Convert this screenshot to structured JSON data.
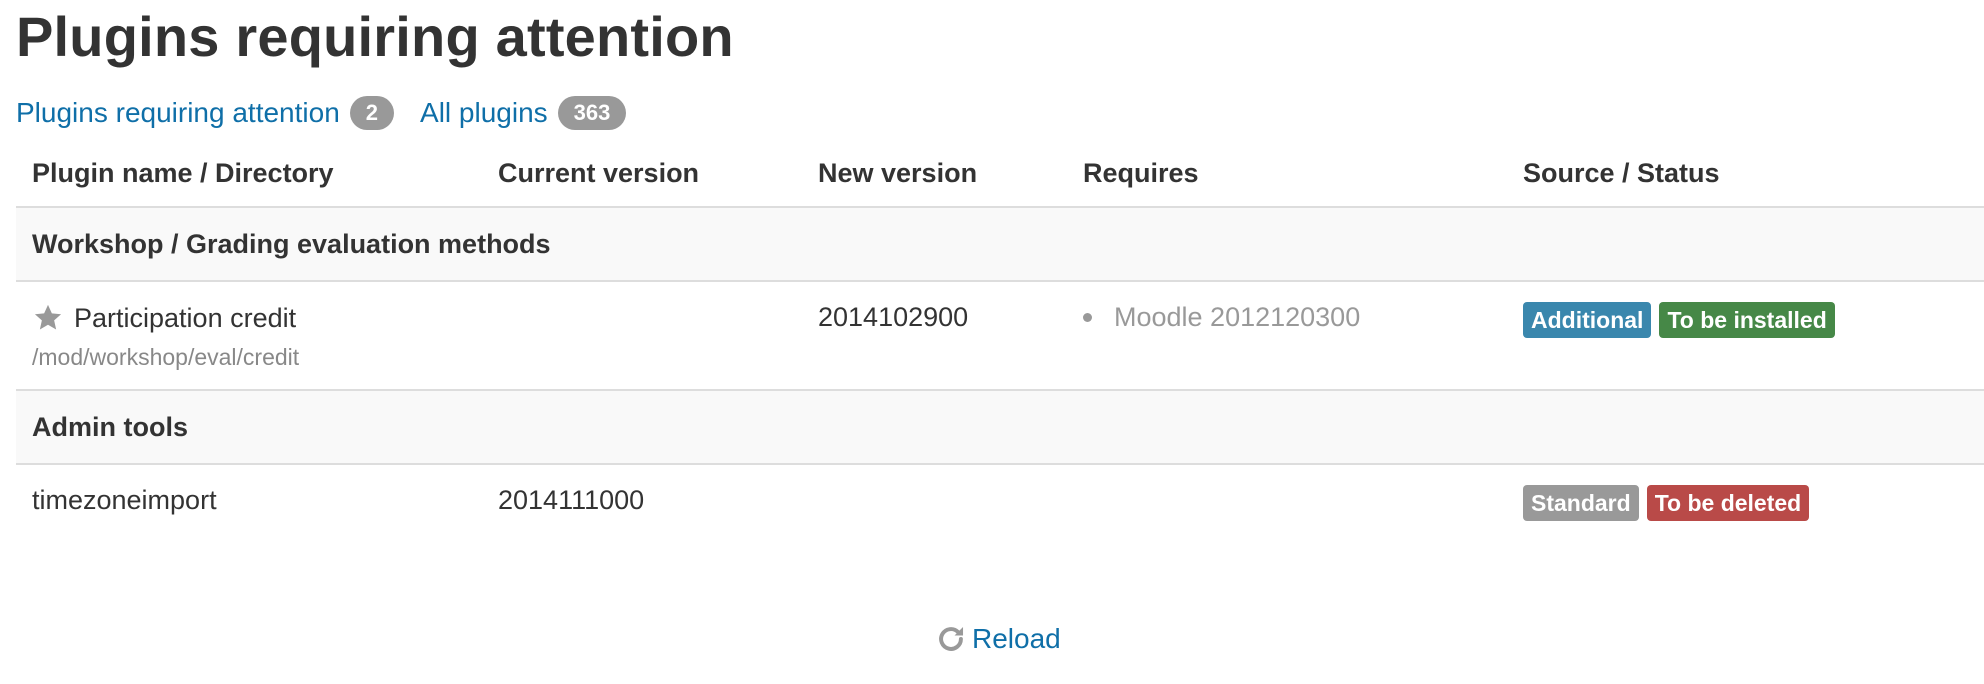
{
  "page_title": "Plugins requiring attention",
  "filters": [
    {
      "label": "Plugins requiring attention",
      "count": "2"
    },
    {
      "label": "All plugins",
      "count": "363"
    }
  ],
  "table": {
    "headers": [
      "Plugin name / Directory",
      "Current version",
      "New version",
      "Requires",
      "Source / Status"
    ],
    "groups": [
      {
        "name": "Workshop / Grading evaluation methods",
        "plugins": [
          {
            "name": "Participation credit",
            "icon": "star-icon",
            "directory": "/mod/workshop/eval/credit",
            "current_version": "",
            "new_version": "2014102900",
            "requires": [
              "Moodle 2012120300"
            ],
            "source": {
              "text": "Additional",
              "color": "#3a87ad"
            },
            "status": {
              "text": "To be installed",
              "color": "#468847"
            }
          }
        ]
      },
      {
        "name": "Admin tools",
        "plugins": [
          {
            "name": "timezoneimport",
            "current_version": "2014111000",
            "new_version": "",
            "requires": [],
            "source": {
              "text": "Standard",
              "color": "#999999"
            },
            "status": {
              "text": "To be deleted",
              "color": "#b94a48"
            }
          }
        ]
      }
    ]
  },
  "reload": {
    "label": "Reload",
    "icon": "reload-icon"
  },
  "colors": {
    "link": "#0f6fa8",
    "text": "#333333",
    "muted": "#999999"
  }
}
